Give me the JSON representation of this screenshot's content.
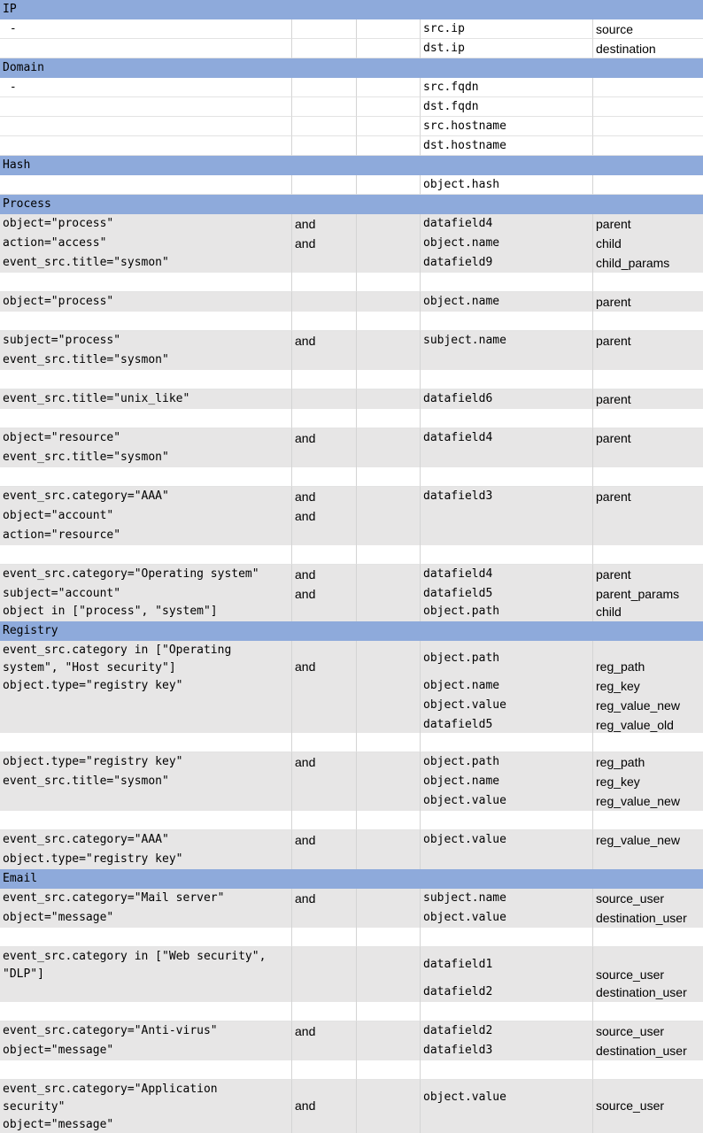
{
  "rows": [
    {
      "kind": "header",
      "label": "IP"
    },
    {
      "kind": "white",
      "c1": [
        " -"
      ],
      "c4": [
        "src.ip"
      ],
      "c5": [
        "source"
      ]
    },
    {
      "kind": "white",
      "c4": [
        "dst.ip"
      ],
      "c5": [
        "destination"
      ]
    },
    {
      "kind": "header",
      "label": "Domain"
    },
    {
      "kind": "white",
      "c1": [
        " -"
      ],
      "c4": [
        "src.fqdn"
      ]
    },
    {
      "kind": "white",
      "c4": [
        "dst.fqdn"
      ]
    },
    {
      "kind": "white",
      "c4": [
        "src.hostname"
      ]
    },
    {
      "kind": "white",
      "c4": [
        "dst.hostname"
      ]
    },
    {
      "kind": "header",
      "label": "Hash"
    },
    {
      "kind": "white",
      "c4": [
        "object.hash"
      ]
    },
    {
      "kind": "header",
      "label": "Process"
    },
    {
      "kind": "gray",
      "c1": [
        "object=\"process\"",
        "action=\"access\"",
        "event_src.title=\"sysmon\""
      ],
      "c2": [
        "and",
        "and"
      ],
      "c4": [
        "datafield4",
        "object.name",
        "datafield9"
      ],
      "c5": [
        "parent",
        "child",
        "child_params"
      ]
    },
    {
      "kind": "white"
    },
    {
      "kind": "gray",
      "c1": [
        "object=\"process\""
      ],
      "c4": [
        "object.name"
      ],
      "c5": [
        "parent"
      ]
    },
    {
      "kind": "white"
    },
    {
      "kind": "gray",
      "c1": [
        "subject=\"process\"",
        "event_src.title=\"sysmon\""
      ],
      "c2": [
        "and"
      ],
      "c4": [
        "subject.name"
      ],
      "c5": [
        "parent"
      ]
    },
    {
      "kind": "white"
    },
    {
      "kind": "gray",
      "c1": [
        "event_src.title=\"unix_like\""
      ],
      "c4": [
        "datafield6"
      ],
      "c5": [
        "parent"
      ]
    },
    {
      "kind": "white"
    },
    {
      "kind": "gray",
      "c1": [
        "object=\"resource\"",
        "event_src.title=\"sysmon\""
      ],
      "c2": [
        "and"
      ],
      "c4": [
        "datafield4"
      ],
      "c5": [
        "parent"
      ]
    },
    {
      "kind": "white"
    },
    {
      "kind": "gray",
      "c1": [
        "event_src.category=\"AAA\"",
        "object=\"account\"",
        "action=\"resource\""
      ],
      "c2": [
        "and",
        "and"
      ],
      "c4": [
        "datafield3"
      ],
      "c5": [
        "parent"
      ]
    },
    {
      "kind": "white"
    },
    {
      "kind": "gray",
      "c1": [
        "event_src.category=\"Operating system\"",
        "subject=\"account\"",
        "object in [\"process\", \"system\"]"
      ],
      "c2": [
        "and",
        "and"
      ],
      "c4": [
        "datafield4",
        "datafield5",
        "object.path"
      ],
      "c5": [
        "parent",
        "parent_params",
        "child"
      ]
    },
    {
      "kind": "header",
      "label": "Registry"
    },
    {
      "kind": "gray",
      "c1": [
        "event_src.category in [\"Operating",
        "system\", \"Host security\"]",
        "object.type=\"registry key\""
      ],
      "c2": [
        "and"
      ],
      "c4": [
        "object.path",
        "object.name",
        "object.value",
        "datafield5"
      ],
      "c5": [
        "reg_path",
        "reg_key",
        "reg_value_new",
        "reg_value_old"
      ]
    },
    {
      "kind": "white"
    },
    {
      "kind": "gray",
      "c1": [
        "object.type=\"registry key\"",
        "event_src.title=\"sysmon\""
      ],
      "c2": [
        "and"
      ],
      "c4": [
        "object.path",
        "object.name",
        "object.value"
      ],
      "c5": [
        "reg_path",
        "reg_key",
        "reg_value_new"
      ]
    },
    {
      "kind": "white"
    },
    {
      "kind": "gray",
      "c1": [
        "event_src.category=\"AAA\"",
        "object.type=\"registry key\""
      ],
      "c2": [
        "and"
      ],
      "c4": [
        "object.value"
      ],
      "c5": [
        "reg_value_new"
      ]
    },
    {
      "kind": "header",
      "label": "Email"
    },
    {
      "kind": "gray",
      "c1": [
        "event_src.category=\"Mail server\"",
        "object=\"message\""
      ],
      "c2": [
        "and"
      ],
      "c4": [
        "subject.name",
        "object.value"
      ],
      "c5": [
        "source_user",
        "destination_user"
      ]
    },
    {
      "kind": "white"
    },
    {
      "kind": "gray",
      "c1": [
        "event_src.category in [\"Web security\",",
        "\"DLP\"]"
      ],
      "c4": [
        "datafield1",
        "datafield2"
      ],
      "c5": [
        "source_user",
        "destination_user"
      ]
    },
    {
      "kind": "white"
    },
    {
      "kind": "gray",
      "c1": [
        "event_src.category=\"Anti-virus\"",
        "object=\"message\""
      ],
      "c2": [
        "and"
      ],
      "c4": [
        "datafield2",
        "datafield3"
      ],
      "c5": [
        "source_user",
        "destination_user"
      ]
    },
    {
      "kind": "white"
    },
    {
      "kind": "gray",
      "c1": [
        "event_src.category=\"Application",
        "security\"",
        "object=\"message\""
      ],
      "c2": [
        "and"
      ],
      "c4": [
        "object.value"
      ],
      "c5": [
        "source_user"
      ]
    }
  ]
}
